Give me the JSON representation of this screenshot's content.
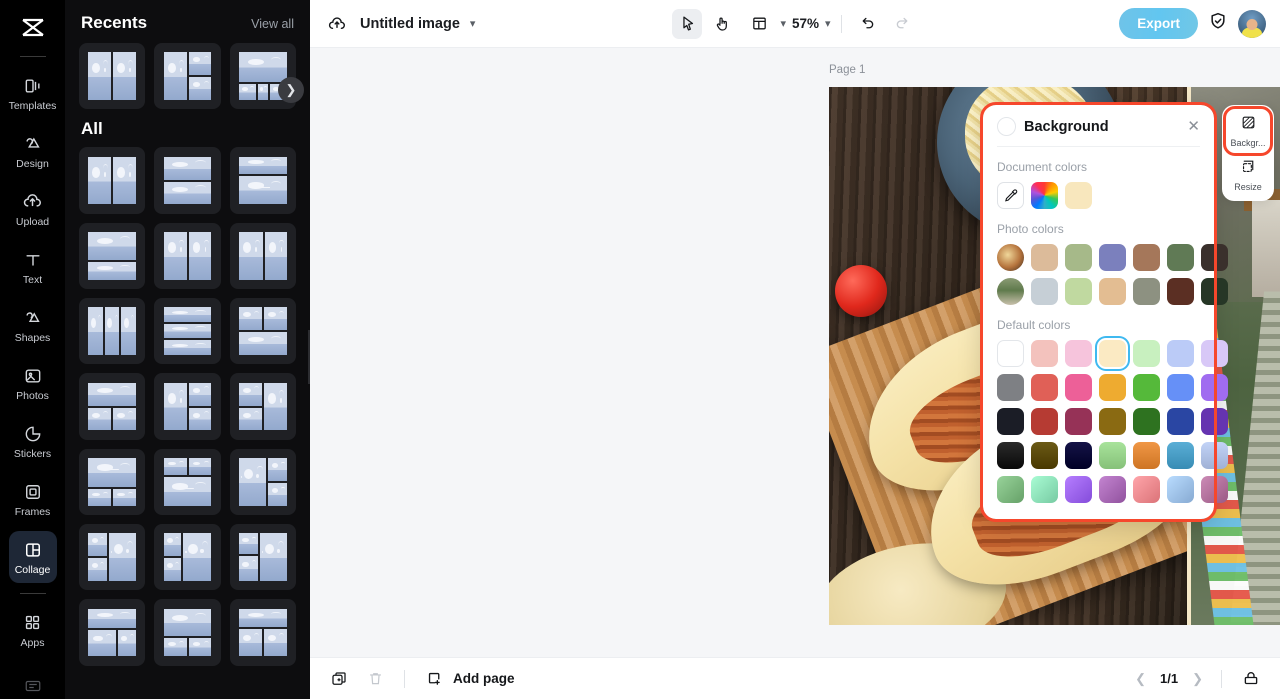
{
  "rail": {
    "logo_icon": "capcut-logo-icon",
    "items": [
      {
        "label": "Templates",
        "icon": "templates-icon"
      },
      {
        "label": "Design",
        "icon": "design-icon"
      },
      {
        "label": "Upload",
        "icon": "upload-cloud-icon"
      },
      {
        "label": "Text",
        "icon": "text-icon"
      },
      {
        "label": "Shapes",
        "icon": "shapes-icon"
      },
      {
        "label": "Photos",
        "icon": "photos-icon"
      },
      {
        "label": "Stickers",
        "icon": "stickers-icon"
      },
      {
        "label": "Frames",
        "icon": "frames-icon"
      },
      {
        "label": "Collage",
        "icon": "collage-icon",
        "active": true
      },
      {
        "label": "Apps",
        "icon": "apps-icon"
      }
    ]
  },
  "panel": {
    "recents_title": "Recents",
    "view_all": "View all",
    "all_title": "All",
    "next_icon": "chevron-right-icon",
    "collapse_icon": "chevron-left-icon",
    "recents": [
      {
        "id": "r1",
        "layout": "2-vertical"
      },
      {
        "id": "r2",
        "layout": "left-tall-right-split"
      },
      {
        "id": "r3",
        "layout": "top-wide-bottom-four"
      }
    ],
    "all": [
      {
        "id": "a1",
        "layout": "2-vertical"
      },
      {
        "id": "a2",
        "layout": "2-horizontal"
      },
      {
        "id": "a3",
        "layout": "top-thin-bottom-big"
      },
      {
        "id": "a4",
        "layout": "big-top-thin-bottom"
      },
      {
        "id": "a5",
        "layout": "2-vertical-b"
      },
      {
        "id": "a6",
        "layout": "2-vertical-c"
      },
      {
        "id": "a7",
        "layout": "3-vertical"
      },
      {
        "id": "a8",
        "layout": "3-horizontal"
      },
      {
        "id": "a9",
        "layout": "two-top-one-bottom"
      },
      {
        "id": "a10",
        "layout": "one-top-two-bottom"
      },
      {
        "id": "a11",
        "layout": "left-tall-right-split"
      },
      {
        "id": "a12",
        "layout": "left-split-right-tall"
      },
      {
        "id": "a13",
        "layout": "big-top-two-small"
      },
      {
        "id": "a14",
        "layout": "two-small-top-big"
      },
      {
        "id": "a15",
        "layout": "left-big-right-two"
      },
      {
        "id": "a16",
        "layout": "left-two-right-big"
      },
      {
        "id": "a17",
        "layout": "big-top-two-bottom"
      },
      {
        "id": "a18",
        "layout": "left-big-right-stack"
      },
      {
        "id": "a19",
        "layout": "left-two-right-big-b"
      },
      {
        "id": "a20",
        "layout": "top-big-two-bottom"
      },
      {
        "id": "a21",
        "layout": "top-wide-two-bottom"
      }
    ]
  },
  "topbar": {
    "cloud_icon": "cloud-upload-icon",
    "doc_title": "Untitled image",
    "title_caret_icon": "chevron-down-icon",
    "tools": [
      {
        "name": "select-tool",
        "icon": "cursor-arrow-icon",
        "active": true
      },
      {
        "name": "hand-tool",
        "icon": "hand-icon",
        "active": false
      },
      {
        "name": "layout-tool",
        "icon": "layout-grid-icon",
        "active": false
      }
    ],
    "layout_caret_icon": "chevron-down-icon",
    "zoom_value": "57%",
    "zoom_caret_icon": "chevron-down-icon",
    "undo_icon": "undo-icon",
    "redo_icon": "redo-icon",
    "export_label": "Export",
    "shield_icon": "shield-check-icon",
    "avatar": "user-avatar"
  },
  "canvas": {
    "page_label": "Page 1",
    "left_photo": "tacos-food-photo",
    "right_photo": "bhutan-prayer-flag-bridge-photo",
    "background_color": "#f6e9c8"
  },
  "background_panel": {
    "title": "Background",
    "close_icon": "close-icon",
    "current_swatch": "#ffffff",
    "document_colors_label": "Document colors",
    "document_colors": [
      {
        "name": "eyedropper",
        "icon": "eyedropper-icon",
        "color": "#ffffff"
      },
      {
        "name": "rainbow-picker",
        "color": "rainbow"
      },
      {
        "name": "cream",
        "color": "#f8e7bd"
      }
    ],
    "photo_colors_label": "Photo colors",
    "photo_colors_rows": [
      {
        "thumb": "tacos-thumb",
        "colors": [
          "#dcbb9a",
          "#a6b989",
          "#7b80bd",
          "#a5775a",
          "#607a55",
          "#3a302c"
        ]
      },
      {
        "thumb": "bridge-thumb",
        "colors": [
          "#c6cfd6",
          "#c0d9a0",
          "#e3bd92",
          "#8d9181",
          "#5b2f23",
          "#263626"
        ]
      }
    ],
    "default_colors_label": "Default colors",
    "default_colors": [
      [
        "#ffffff",
        "#f3c2bd",
        "#f6c4dc",
        "#fbeac3",
        "#c8f0bf",
        "#bbcbf7",
        "#d8c8f7"
      ],
      [
        "#7e8084",
        "#e06057",
        "#ed6098",
        "#eeab30",
        "#55b93a",
        "#6690f7",
        "#a06cf0"
      ],
      [
        "#1b1d26",
        "#b63b33",
        "#963257",
        "#8a6a12",
        "#2e7220",
        "#2a46a3",
        "#6534b0"
      ],
      [
        "#2b2b2b",
        "#6b5a16",
        "#151347",
        "#a8e39b",
        "#f09746",
        "#5aaed6",
        "#c2d3f7"
      ],
      [
        "#7cb77e",
        "#8de0b8",
        "#9a62f0",
        "#a768b4",
        "#f1898e",
        "#9dc0e8",
        "#b06f9a"
      ]
    ],
    "selected_index": "0,3"
  },
  "right_rail": {
    "items": [
      {
        "label": "Backgr...",
        "icon": "background-icon",
        "highlighted": true
      },
      {
        "label": "Resize",
        "icon": "resize-icon",
        "highlighted": false
      }
    ]
  },
  "bottombar": {
    "duplicate_icon": "duplicate-page-icon",
    "delete_icon": "trash-icon",
    "add_page_icon": "add-page-icon",
    "add_page_label": "Add page",
    "prev_icon": "chevron-left-icon",
    "page_indicator": "1/1",
    "next_icon": "chevron-right-icon",
    "timeline_icon": "timeline-icon"
  }
}
